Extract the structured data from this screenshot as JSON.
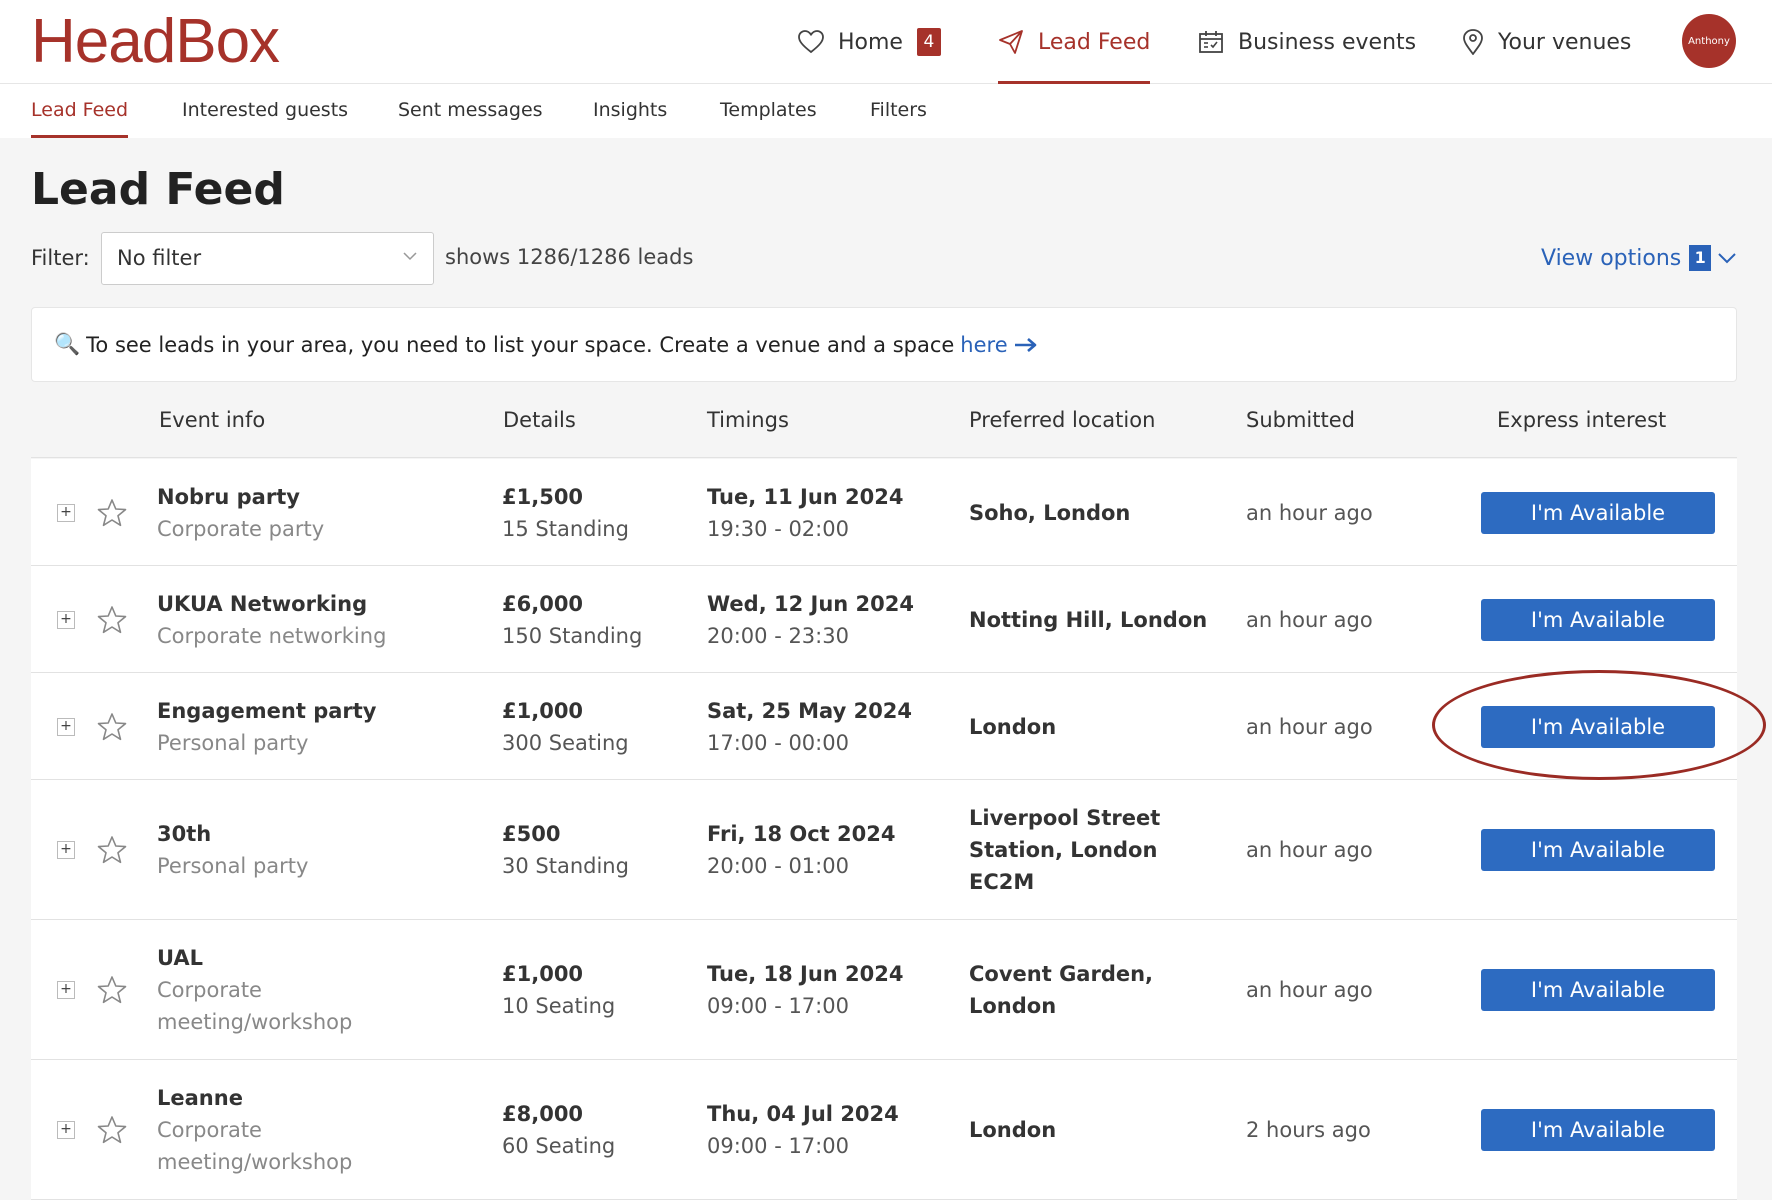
{
  "header": {
    "logo": "HeadBox",
    "nav": [
      {
        "label": "Home",
        "badge": "4"
      },
      {
        "label": "Lead Feed"
      },
      {
        "label": "Business events"
      },
      {
        "label": "Your venues"
      }
    ],
    "avatar": "Anthony"
  },
  "subnav": [
    "Lead Feed",
    "Interested guests",
    "Sent messages",
    "Insights",
    "Templates",
    "Filters"
  ],
  "page": {
    "title": "Lead Feed"
  },
  "filter": {
    "label": "Filter:",
    "value": "No filter",
    "count_text": "shows 1286/1286 leads"
  },
  "view_options": {
    "label": "View options",
    "badge": "1"
  },
  "notice": {
    "icon": "🔍",
    "text": "To see leads in your area, you need to list your space. Create a venue and a space",
    "link": "here"
  },
  "table": {
    "headers": [
      "Event info",
      "Details",
      "Timings",
      "Preferred location",
      "Submitted",
      "Express interest"
    ],
    "button_label": "I'm Available",
    "rows": [
      {
        "name": "Nobru party",
        "type": [
          "Corporate party"
        ],
        "price": "£1,500",
        "guests": "15 Standing",
        "date": "Tue, 11 Jun 2024",
        "time": "19:30 - 02:00",
        "location": [
          "Soho, London"
        ],
        "submitted": "an hour ago"
      },
      {
        "name": "UKUA Networking",
        "type": [
          "Corporate networking"
        ],
        "price": "£6,000",
        "guests": "150 Standing",
        "date": "Wed, 12 Jun 2024",
        "time": "20:00 - 23:30",
        "location": [
          "Notting Hill, London"
        ],
        "submitted": "an hour ago"
      },
      {
        "name": "Engagement party",
        "type": [
          "Personal party"
        ],
        "price": "£1,000",
        "guests": "300 Seating",
        "date": "Sat, 25 May 2024",
        "time": "17:00 - 00:00",
        "location": [
          "London"
        ],
        "submitted": "an hour ago"
      },
      {
        "name": "30th",
        "type": [
          "Personal party"
        ],
        "price": "£500",
        "guests": "30 Standing",
        "date": "Fri, 18 Oct 2024",
        "time": "20:00 - 01:00",
        "location": [
          "Liverpool Street",
          "Station, London",
          "EC2M"
        ],
        "submitted": "an hour ago"
      },
      {
        "name": "UAL",
        "type": [
          "Corporate",
          "meeting/workshop"
        ],
        "price": "£1,000",
        "guests": "10 Seating",
        "date": "Tue, 18 Jun 2024",
        "time": "09:00 - 17:00",
        "location": [
          "Covent Garden,",
          "London"
        ],
        "submitted": "an hour ago"
      },
      {
        "name": "Leanne",
        "type": [
          "Corporate",
          "meeting/workshop"
        ],
        "price": "£8,000",
        "guests": "60 Seating",
        "date": "Thu, 04 Jul 2024",
        "time": "09:00 - 17:00",
        "location": [
          "London"
        ],
        "submitted": "2 hours ago"
      }
    ]
  }
}
